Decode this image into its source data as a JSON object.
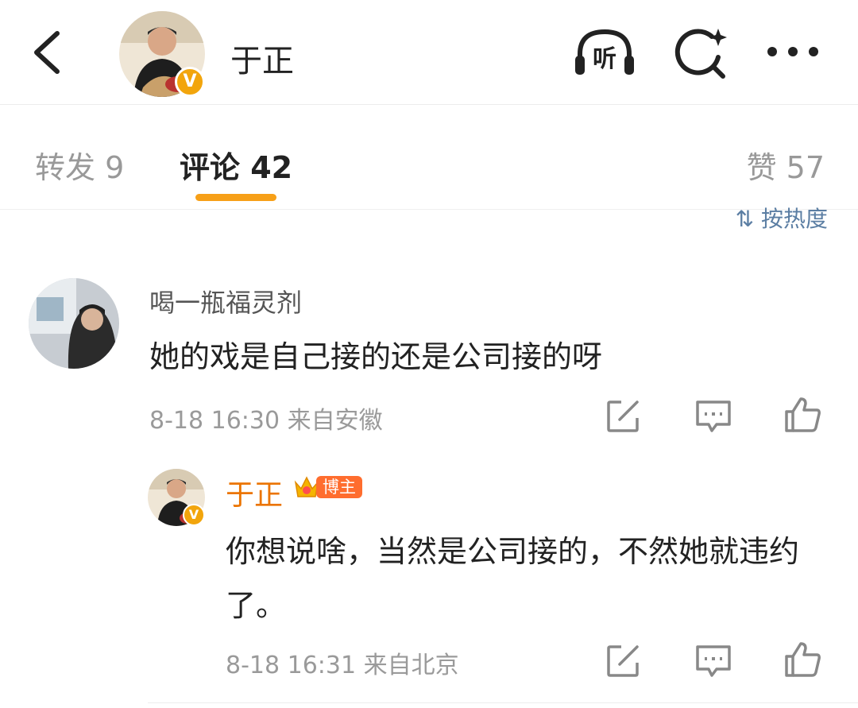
{
  "header": {
    "title": "于正",
    "back_icon": "chevron-left-icon",
    "listen_label": "听",
    "search_icon": "search-sparkle-icon",
    "more_icon": "more-dots-icon",
    "verified_mark": "V"
  },
  "tabs": {
    "repost": "转发 9",
    "comments": "评论 42",
    "likes": "赞 57",
    "accent_color": "#f7a018"
  },
  "sort": {
    "label": "按热度"
  },
  "comments": [
    {
      "author": "喝一瓶福灵剂",
      "text": "她的戏是自己接的还是公司接的呀",
      "meta": "8-18 16:30 来自安徽",
      "reply": {
        "author": "于正",
        "badge": "博主",
        "text": "你想说啥，当然是公司接的，不然她就违约了。",
        "meta": "8-18 16:31 来自北京"
      }
    }
  ],
  "colors": {
    "author_highlight": "#eb7400",
    "link_blue": "#5b7ea3",
    "badge_orange": "#ff6d2e"
  }
}
